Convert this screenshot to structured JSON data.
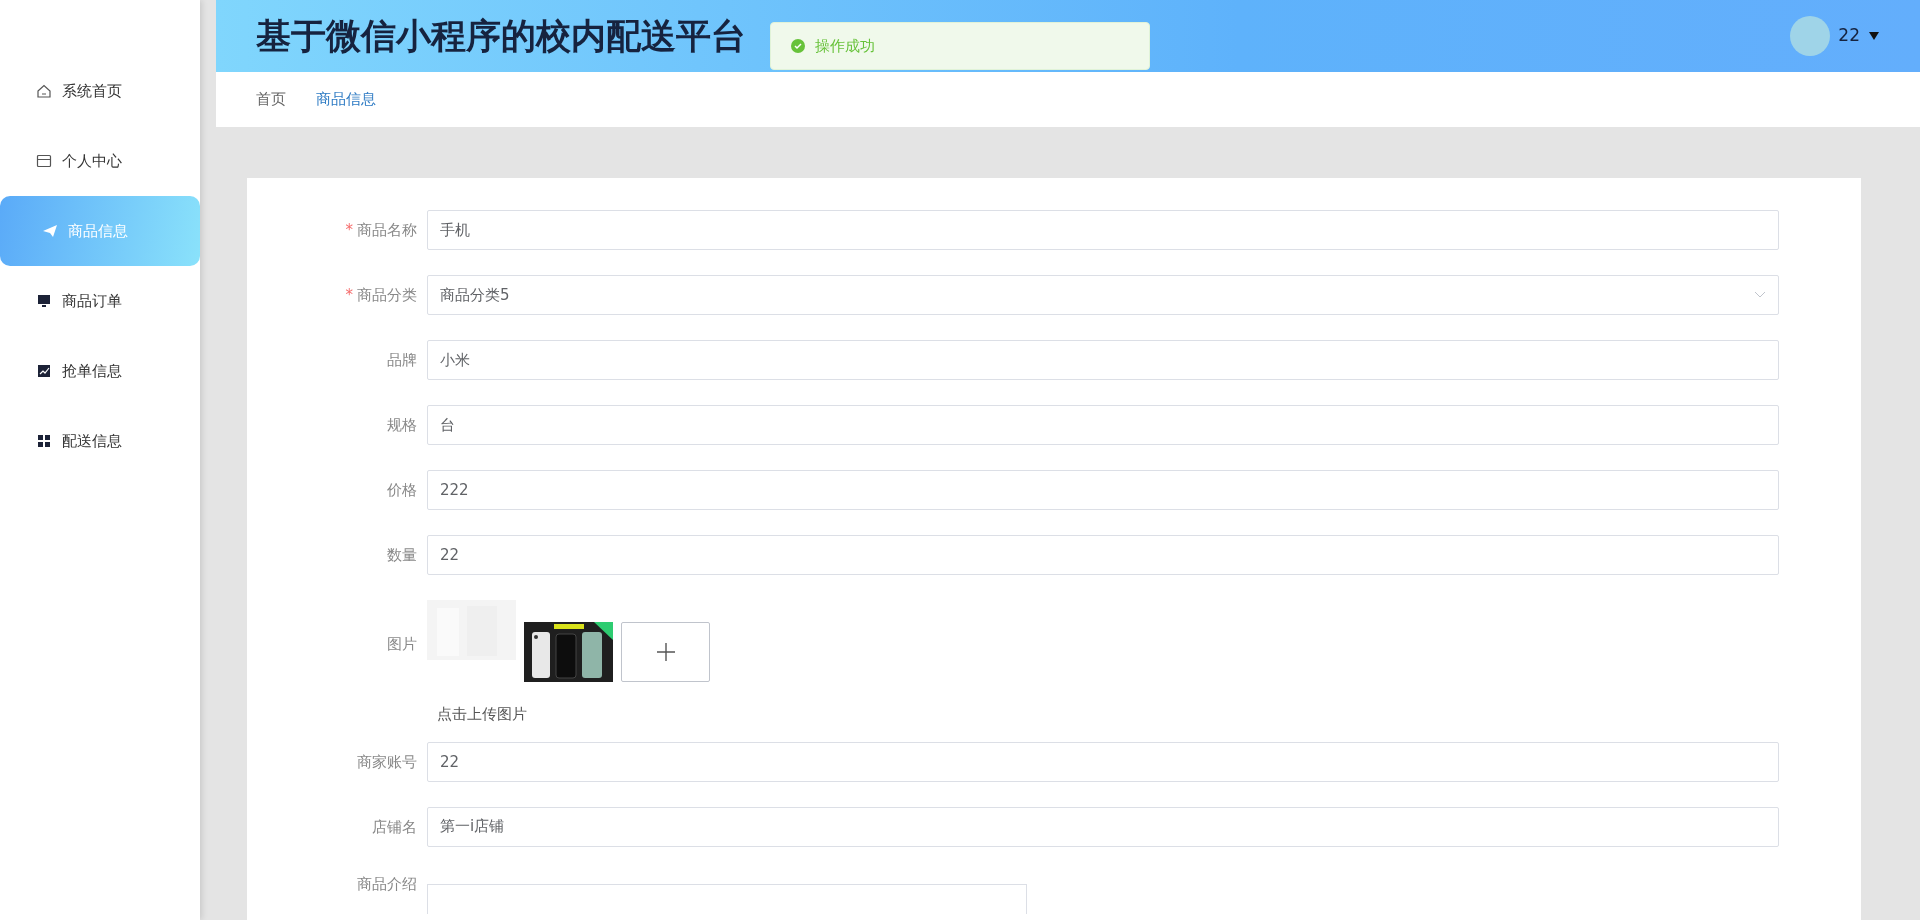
{
  "header": {
    "title": "基于微信小程序的校内配送平台",
    "user": "22"
  },
  "toast": {
    "kind": "success",
    "text": "操作成功"
  },
  "sidebar": {
    "items": [
      {
        "label": "系统首页",
        "selected": false
      },
      {
        "label": "个人中心",
        "selected": false
      },
      {
        "label": "商品信息",
        "selected": true
      },
      {
        "label": "商品订单",
        "selected": false
      },
      {
        "label": "抢单信息",
        "selected": false
      },
      {
        "label": "配送信息",
        "selected": false
      }
    ]
  },
  "breadcrumb": [
    {
      "label": "首页",
      "selected": false
    },
    {
      "label": "商品信息",
      "selected": true
    }
  ],
  "form": {
    "fields": [
      {
        "kind": "text",
        "label": "商品名称",
        "required": "*",
        "value": "手机"
      },
      {
        "kind": "select",
        "label": "商品分类",
        "required": "*",
        "value": "商品分类5"
      },
      {
        "kind": "text",
        "label": "品牌",
        "value": "小米"
      },
      {
        "kind": "text",
        "label": "规格",
        "value": "台"
      },
      {
        "kind": "text",
        "label": "价格",
        "value": "222"
      },
      {
        "kind": "text",
        "label": "数量",
        "value": "22"
      },
      {
        "kind": "images",
        "label": "图片",
        "hint": "点击上传图片"
      },
      {
        "kind": "text",
        "label": "商家账号",
        "value": "22"
      },
      {
        "kind": "text",
        "label": "店铺名",
        "value": "第一i店铺"
      },
      {
        "kind": "textarea",
        "label": "商品介绍"
      }
    ]
  }
}
